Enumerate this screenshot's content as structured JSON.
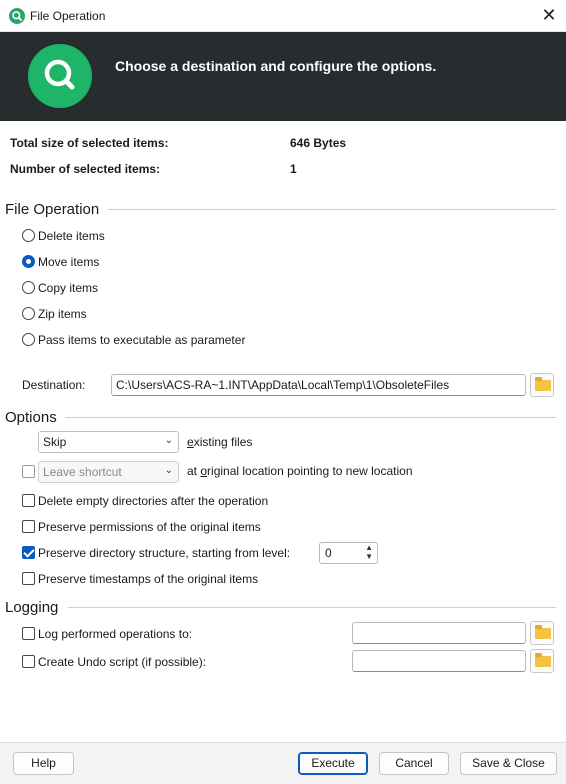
{
  "window": {
    "title": "File Operation",
    "close_glyph": "✕",
    "icon": "search-icon"
  },
  "banner": {
    "message": "Choose a destination and configure the options.",
    "icon": "search-icon",
    "accent": "#1fb568"
  },
  "summary": {
    "total_size_label": "Total size of selected items:",
    "total_size_value": "646 Bytes",
    "count_label": "Number of selected items:",
    "count_value": "1"
  },
  "file_operation": {
    "title": "File Operation",
    "options": [
      {
        "label": "Delete items",
        "selected": false
      },
      {
        "label": "Move items",
        "selected": true
      },
      {
        "label": "Copy items",
        "selected": false
      },
      {
        "label": "Zip items",
        "selected": false
      },
      {
        "label": "Pass items to executable as parameter",
        "selected": false
      }
    ],
    "destination_label": "Destination:",
    "destination_value": "C:\\Users\\ACS-RA~1.INT\\AppData\\Local\\Temp\\1\\ObsoleteFiles"
  },
  "options": {
    "title": "Options",
    "existing_select": "Skip",
    "existing_label_pre": "",
    "existing_label_u": "e",
    "existing_label_post": "xisting files",
    "shortcut_select": "Leave shortcut",
    "shortcut_label_pre": "at ",
    "shortcut_label_u": "o",
    "shortcut_label_post": "riginal location pointing to new location",
    "delete_empty": "Delete empty directories after the operation",
    "preserve_permissions": "Preserve permissions of the original items",
    "preserve_structure": "Preserve directory structure, starting from level:",
    "structure_level": "0",
    "preserve_timestamps": "Preserve timestamps of the original items"
  },
  "logging": {
    "title": "Logging",
    "log_label": "Log performed operations to:",
    "log_value": "",
    "undo_label": "Create Undo script (if possible):",
    "undo_value": ""
  },
  "footer": {
    "help": "Help",
    "execute": "Execute",
    "cancel": "Cancel",
    "save_close": "Save & Close"
  }
}
